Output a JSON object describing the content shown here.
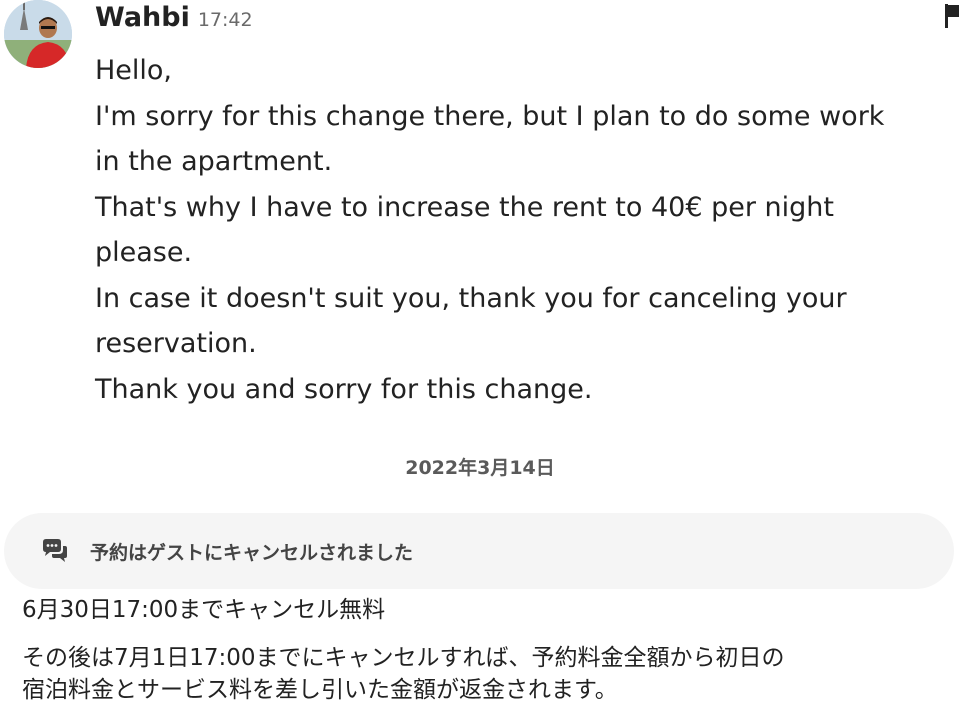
{
  "message": {
    "sender_name": "Wahbi",
    "time": "17:42",
    "avatar_icon": "user-avatar-photo",
    "lines": [
      "Hello,",
      "I'm sorry for this change there, but I plan to do some work",
      "in the apartment.",
      "That's why I have to increase the rent to 40€ per night",
      "please.",
      "In case it doesn't suit you, thank you for canceling your",
      "reservation.",
      "Thank you and sorry for this change."
    ]
  },
  "date_separator": "2022年3月14日",
  "notice": {
    "icon": "chat-bubbles-icon",
    "text": "予約はゲストにキャンセルされました"
  },
  "policy": {
    "title": "6月30日17:00までキャンセル無料",
    "body_lines": [
      "その後は7月1日17:00までにキャンセルすれば、予約料金全額から初日の",
      "宿泊料金とサービス料を差し引いた金額が返金されます。"
    ]
  },
  "colors": {
    "text": "#222222",
    "muted": "#6a6a6a",
    "notice_bg": "#f5f5f5"
  }
}
